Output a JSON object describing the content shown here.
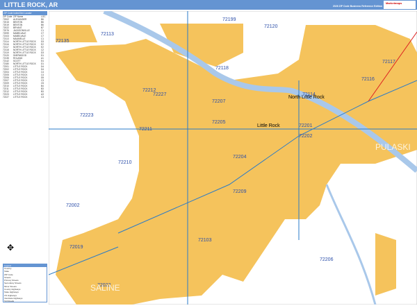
{
  "header": {
    "title": "LITTLE ROCK, AR",
    "subtitle": "2026 ZIP Code Business Reference Edition",
    "logo_text": "Marketmaps"
  },
  "index": {
    "title": "ZIP Code Index/Grid Locator",
    "columns": [
      "ZIP Code",
      "ZIP Name",
      "LOC"
    ],
    "rows": [
      [
        "72002",
        "ALEXANDER",
        "B6"
      ],
      [
        "72015",
        "BENTON",
        "B6"
      ],
      [
        "72019",
        "BENTON",
        "B6"
      ],
      [
        "72022",
        "BRYANT",
        "B7"
      ],
      [
        "72076",
        "JACKSONVILLE",
        "C1"
      ],
      [
        "72099",
        "MABELVALE",
        "C7"
      ],
      [
        "72103",
        "MABELVALE",
        "C7"
      ],
      [
        "72113",
        "MAUMELLE",
        "C1"
      ],
      [
        "72114",
        "NORTH LITTLE ROCK",
        "D3"
      ],
      [
        "72116",
        "NORTH LITTLE ROCK",
        "E2"
      ],
      [
        "72117",
        "NORTH LITTLE ROCK",
        "E2"
      ],
      [
        "72118",
        "NORTH LITTLE ROCK",
        "C2"
      ],
      [
        "72119",
        "NORTH LITTLE ROCK",
        "D3"
      ],
      [
        "72120",
        "SHERWOOD",
        "D1"
      ],
      [
        "72135",
        "ROLAND",
        "A1"
      ],
      [
        "72142",
        "SCOTT",
        "E4"
      ],
      [
        "72180",
        "NORTH LITTLE ROCK",
        "D1"
      ],
      [
        "72201",
        "LITTLE ROCK",
        "D4"
      ],
      [
        "72202",
        "LITTLE ROCK",
        "D4"
      ],
      [
        "72204",
        "LITTLE ROCK",
        "C4"
      ],
      [
        "72205",
        "LITTLE ROCK",
        "C4"
      ],
      [
        "72206",
        "LITTLE ROCK",
        "D5"
      ],
      [
        "72207",
        "LITTLE ROCK",
        "C3"
      ],
      [
        "72209",
        "LITTLE ROCK",
        "C5"
      ],
      [
        "72210",
        "LITTLE ROCK",
        "B4"
      ],
      [
        "72211",
        "LITTLE ROCK",
        "B3"
      ],
      [
        "72212",
        "LITTLE ROCK",
        "B3"
      ],
      [
        "72223",
        "LITTLE ROCK",
        "A3"
      ],
      [
        "72227",
        "LITTLE ROCK",
        "C3"
      ]
    ]
  },
  "legend": {
    "title": "Legend",
    "items": [
      "Country",
      "State",
      "ZIP Code",
      "Streets",
      "Primary Streets",
      "Secondary Streets",
      "Minor Streets",
      "County Highways",
      "State Highways",
      "US Highways",
      "Interstate Highways",
      "Toll Roads"
    ]
  },
  "map": {
    "zip_labels": [
      "72135",
      "72113",
      "72199",
      "72120",
      "72117",
      "72118",
      "72116",
      "72212",
      "72227",
      "72207",
      "72114",
      "72223",
      "72211",
      "72205",
      "72201",
      "72202",
      "72210",
      "72204",
      "72209",
      "72002",
      "72019",
      "72103",
      "72206",
      "72022"
    ],
    "cities": [
      "North Little Rock",
      "Little Rock"
    ],
    "counties": [
      "SALINE",
      "PULASKI"
    ],
    "colors": {
      "urban": "#f5c35c",
      "water": "#a9c8ea",
      "header": "#6494d2"
    }
  }
}
